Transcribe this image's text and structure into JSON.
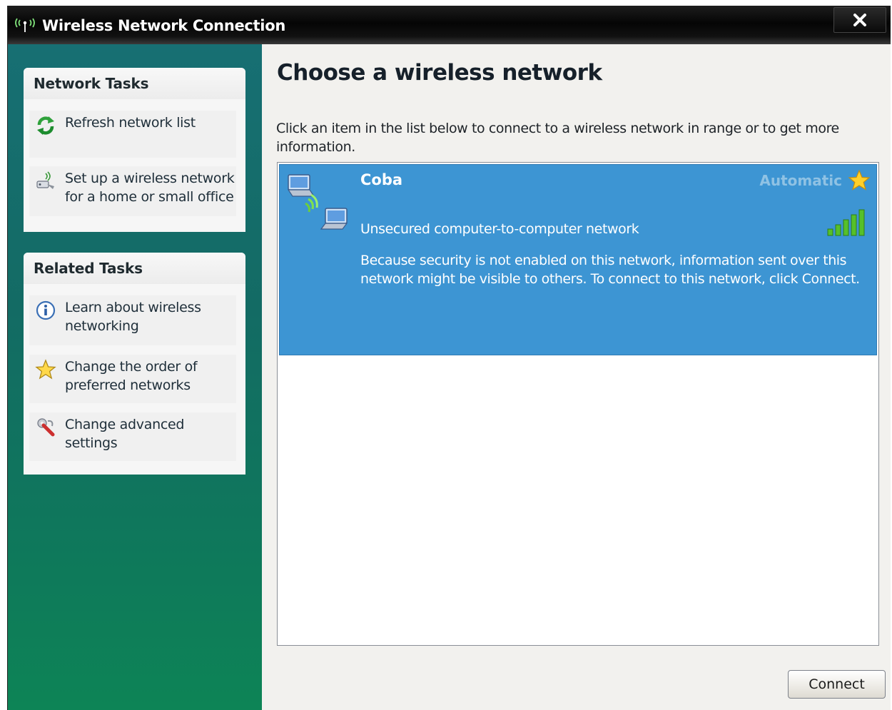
{
  "window": {
    "title": "Wireless Network Connection",
    "icons": {
      "title": "wireless-antenna-icon",
      "close": "close-x-icon"
    }
  },
  "sidebar": {
    "network_tasks": {
      "header": "Network Tasks",
      "items": [
        {
          "label": "Refresh network list",
          "icon": "refresh-arrows-icon"
        },
        {
          "label": "Set up a wireless network for a home or small office",
          "icon": "wireless-setup-icon"
        }
      ]
    },
    "related_tasks": {
      "header": "Related Tasks",
      "items": [
        {
          "label": "Learn about wireless networking",
          "icon": "info-icon"
        },
        {
          "label": "Change the order of preferred networks",
          "icon": "star-icon"
        },
        {
          "label": "Change advanced settings",
          "icon": "wrench-icon"
        }
      ]
    }
  },
  "main": {
    "heading": "Choose a wireless network",
    "instruction": "Click an item in the list below to connect to a wireless network in range or to get more information.",
    "networks": [
      {
        "name": "Coba",
        "status": "Automatic",
        "type": "Unsecured computer-to-computer network",
        "description": "Because security is not enabled on this network, information sent over this network might be visible to others. To connect to this network, click Connect.",
        "signal_bars": 5,
        "selected": true,
        "icons": {
          "network": "computer-to-computer-icon",
          "preferred": "star-icon",
          "signal": "signal-strength-icon"
        }
      }
    ],
    "connect_label": "Connect"
  },
  "colors": {
    "selection": "#3d95d3",
    "sidebar_top": "#176f73",
    "sidebar_bottom": "#0d8456",
    "titlebar": "#0a0a0a",
    "signal": "#56c02a"
  }
}
